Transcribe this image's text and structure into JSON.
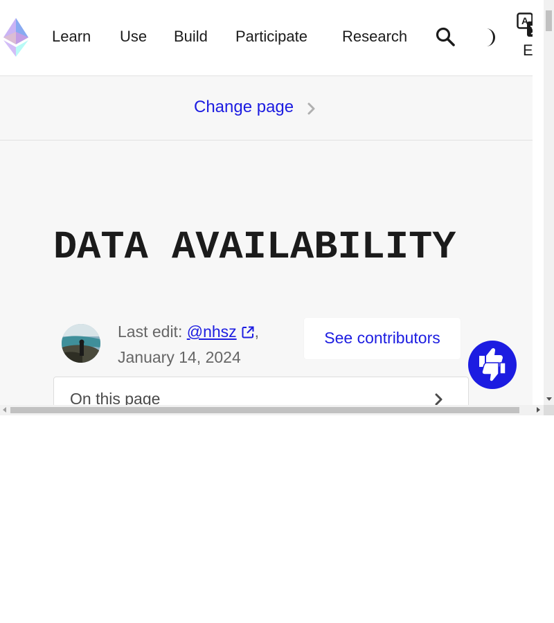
{
  "nav": {
    "items": [
      {
        "label": "Learn"
      },
      {
        "label": "Use"
      },
      {
        "label": "Build"
      },
      {
        "label": "Participate"
      },
      {
        "label": "Research"
      }
    ],
    "language": "EN"
  },
  "change_page": {
    "label": "Change page"
  },
  "page": {
    "title": "DATA AVAILABILITY"
  },
  "meta": {
    "last_edit_prefix": "Last edit: ",
    "author": "@nhsz",
    "date": "January 14, 2024"
  },
  "buttons": {
    "see_contributors": "See contributors"
  },
  "toc": {
    "label": "On this page"
  },
  "colors": {
    "accent": "#1c1ce1",
    "background": "#f7f7f7",
    "text": "#1b1b1b"
  }
}
